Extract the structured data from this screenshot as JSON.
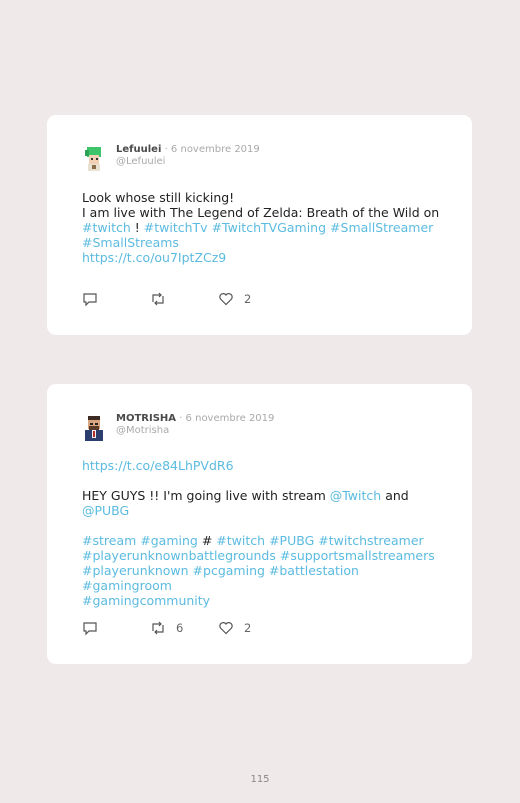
{
  "tweets": [
    {
      "name": "Lefuulei",
      "date": "· 6 novembre 2019",
      "handle": "@Lefuulei",
      "line1": "Look whose still kicking!",
      "line2": "I am live with The Legend of Zelda: Breath of the Wild on",
      "tags_line1": [
        "#twitch",
        "!",
        "#twitchTv",
        "#TwitchTVGaming",
        "#SmallStreamer"
      ],
      "tags_line2": "#SmallStreams",
      "link": "https://t.co/ou7IptZCz9",
      "retweets": "",
      "likes": "2"
    },
    {
      "name": "MOTRISHA",
      "date": "· 6 novembre 2019",
      "handle": "@Motrisha",
      "link": "https://t.co/e84LhPVdR6",
      "text_a": "HEY GUYS !! I'm going live with stream",
      "mention1": "@Twitch",
      "and": "and",
      "mention2": "@PUBG",
      "tags_a": [
        "#stream",
        "#gaming",
        "#",
        "#twitch",
        "#PUBG",
        "#twitchstreamer"
      ],
      "tags_b": "#playerunknownbattlegrounds #supportsmallstreamers",
      "tags_c": "#playerunknown #pcgaming #battlestation #gamingroom",
      "tags_d": "#gamingcommunity",
      "retweets": "6",
      "likes": "2"
    }
  ],
  "page_number": "115"
}
